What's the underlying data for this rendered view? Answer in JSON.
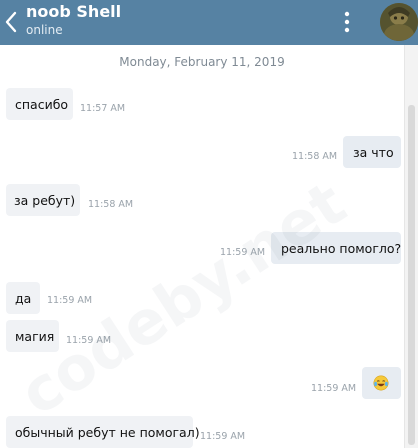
{
  "header": {
    "title": "noob Shell",
    "status": "online",
    "background_color": "#5682a3"
  },
  "icons": {
    "back": "chevron-left-icon",
    "menu": "more-vertical-icon",
    "avatar": "avatar"
  },
  "date_separator": "Monday, February 11, 2019",
  "watermark": "codeby.net",
  "messages": [
    {
      "direction": "incoming",
      "text": "спасибо",
      "time": "11:57 AM"
    },
    {
      "direction": "outgoing",
      "text": "за что",
      "time": "11:58 AM"
    },
    {
      "direction": "incoming",
      "text": "за ребут)",
      "time": "11:58 AM"
    },
    {
      "direction": "outgoing",
      "text": "реально помогло?",
      "time": "11:59 AM"
    },
    {
      "direction": "incoming",
      "text": "да",
      "time": "11:59 AM"
    },
    {
      "direction": "incoming",
      "text": "магия",
      "time": "11:59 AM"
    },
    {
      "direction": "outgoing",
      "text": "",
      "emoji": "face-with-tears-of-joy",
      "time": "11:59 AM"
    },
    {
      "direction": "incoming",
      "text": "обычный ребут не помогал)",
      "time": "11:59 AM"
    }
  ]
}
